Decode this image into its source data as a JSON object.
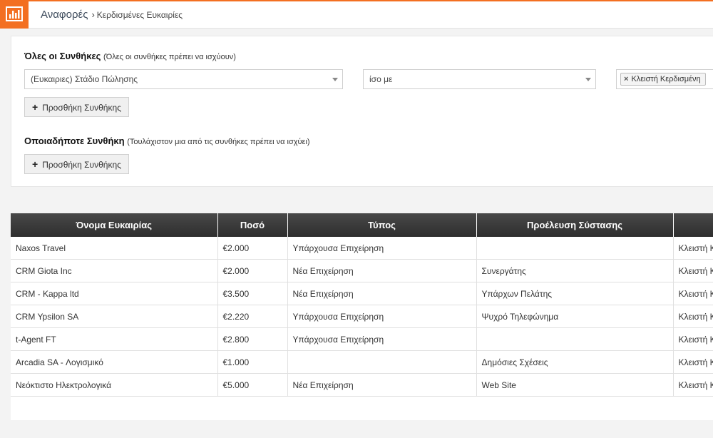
{
  "breadcrumb": {
    "section": "Αναφορές",
    "separator": "›",
    "page": "Κερδισμένες Ευκαιρίες"
  },
  "icons": {
    "app": "bar-chart-icon",
    "dropdown": "chevron-down-icon",
    "remove_tag": "close-icon",
    "add": "plus-icon"
  },
  "colors": {
    "accent": "#f36f21",
    "table_header": "#3a3a3a"
  },
  "filters": {
    "all_conditions": {
      "title": "Όλες οι Συνθήκες",
      "hint": "(Όλες οι συνθήκες πρέπει να ισχύουν)",
      "field_select": "(Ευκαιριες) Στάδιο Πώλησης",
      "operator_select": "ίσο με",
      "value_tag": "Κλειστή Κερδισμένη",
      "add_button": "Προσθήκη Συνθήκης"
    },
    "any_condition": {
      "title": "Οποιαδήποτε Συνθήκη",
      "hint": "(Τουλάχιστον μια από τις συνθήκες πρέπει να ισχύει)",
      "add_button": "Προσθήκη Συνθήκης"
    }
  },
  "table": {
    "columns": [
      "Όνομα Ευκαιρίας",
      "Ποσό",
      "Τύπος",
      "Προέλευση Σύστασης",
      ""
    ],
    "rows": [
      [
        "Naxos Travel",
        "€2.000",
        "Υπάρχουσα Επιχείρηση",
        "",
        "Κλειστή Κ"
      ],
      [
        "CRM Giota Inc",
        "€2.000",
        "Νέα Επιχείρηση",
        "Συνεργάτης",
        "Κλειστή Κ"
      ],
      [
        "CRM - Kappa ltd",
        "€3.500",
        "Νέα Επιχείρηση",
        "Υπάρχων Πελάτης",
        "Κλειστή Κ"
      ],
      [
        "CRM Ypsilon SA",
        "€2.220",
        "Υπάρχουσα Επιχείρηση",
        "Ψυχρό Τηλεφώνημα",
        "Κλειστή Κ"
      ],
      [
        "t-Agent FT",
        "€2.800",
        "Υπάρχουσα Επιχείρηση",
        "",
        "Κλειστή Κ"
      ],
      [
        "Arcadia SA - Λογισμικό",
        "€1.000",
        "",
        "Δημόσιες Σχέσεις",
        "Κλειστή Κ"
      ],
      [
        "Νεόκτιστο Ηλεκτρολογικά",
        "€5.000",
        "Νέα Επιχείρηση",
        "Web Site",
        "Κλειστή Κ"
      ]
    ]
  }
}
